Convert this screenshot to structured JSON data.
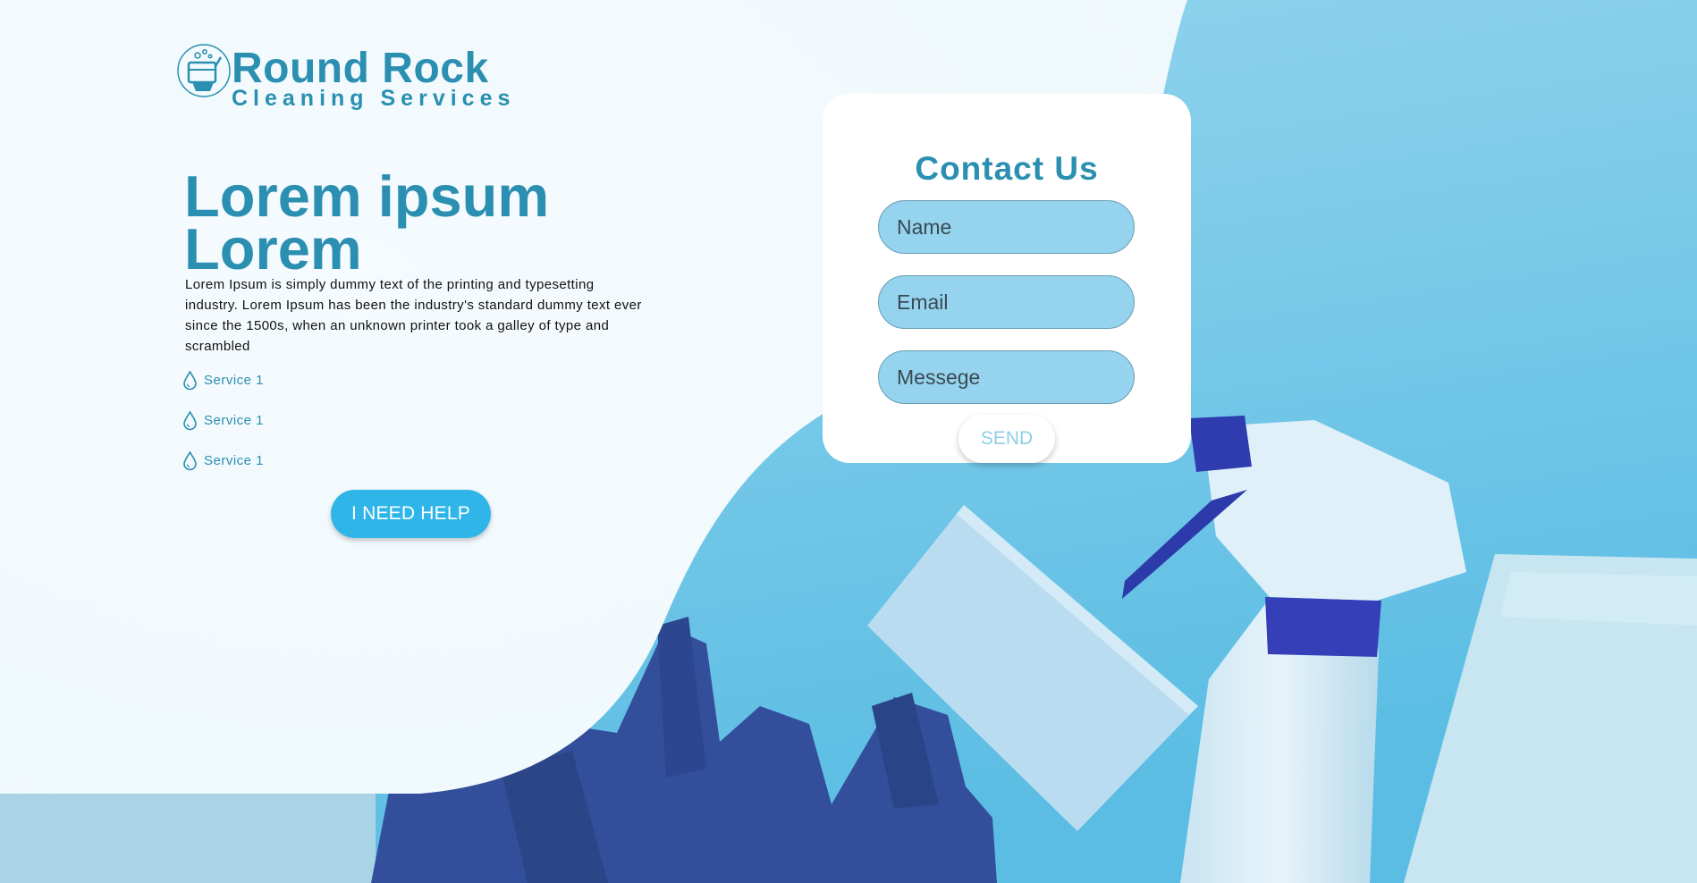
{
  "brand": {
    "title": "Round Rock",
    "subtitle": "Cleaning Services",
    "logo_icon": "window-squeegee-bucket-icon"
  },
  "hero": {
    "headline": "Lorem ipsum Lorem",
    "paragraph": "Lorem Ipsum is simply dummy text of the printing and typesetting industry. Lorem Ipsum has been the industry's standard dummy text ever since the 1500s, when an unknown printer took a galley of type and scrambled",
    "services": [
      {
        "label": "Service 1",
        "icon": "water-drop-icon"
      },
      {
        "label": "Service 1",
        "icon": "water-drop-icon"
      },
      {
        "label": "Service 1",
        "icon": "water-drop-icon"
      }
    ],
    "cta_label": "I NEED HELP",
    "background_image": "cleaning supplies: blue rubber gloves, sponge, spray bottle and towel on blue background"
  },
  "contact": {
    "title": "Contact Us",
    "name_placeholder": "Name",
    "email_placeholder": "Email",
    "message_placeholder": "Messege",
    "send_label": "SEND"
  },
  "colors": {
    "brand_teal": "#2a8fb0",
    "cta_blue": "#2fb5e8",
    "field_fill": "#95d3ee",
    "page_light": "#f4fafd",
    "backdrop_blue": "#8fd3eb"
  }
}
